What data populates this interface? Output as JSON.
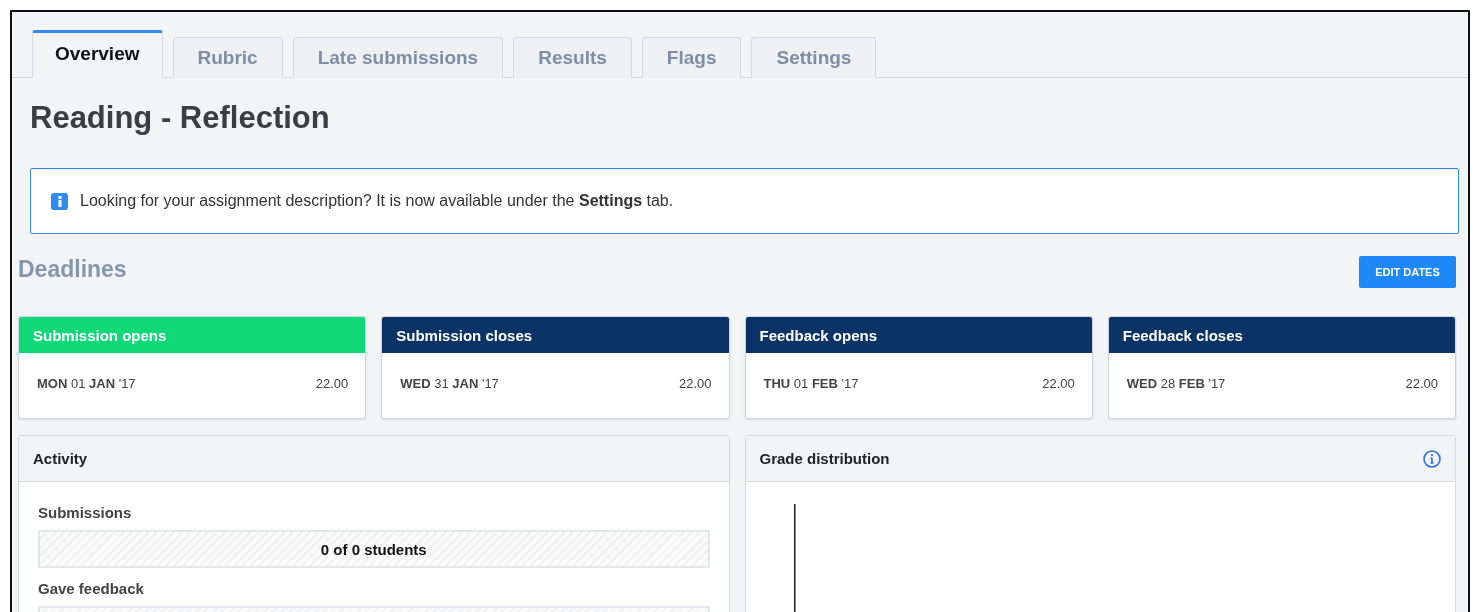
{
  "tabs": [
    {
      "label": "Overview",
      "selected": true
    },
    {
      "label": "Rubric",
      "selected": false
    },
    {
      "label": "Late submissions",
      "selected": false
    },
    {
      "label": "Results",
      "selected": false
    },
    {
      "label": "Flags",
      "selected": false
    },
    {
      "label": "Settings",
      "selected": false
    }
  ],
  "title": "Reading - Reflection",
  "notice": "Looking for your assignment description? It is now available under the **Settings** tab.",
  "deadlines": {
    "heading": "Deadlines",
    "button": "EDIT DATES",
    "cards": [
      {
        "label": "Submission opens",
        "color": "#0fd878",
        "date": "**MON** 01 **JAN** '17",
        "time": "22.00"
      },
      {
        "label": "Submission closes",
        "color": "#0b3365",
        "date": "**WED** 31 **JAN** '17",
        "time": "22.00"
      },
      {
        "label": "Feedback opens",
        "color": "#0b3365",
        "date": "**THU** 01 **FEB** '17",
        "time": "22.00"
      },
      {
        "label": "Feedback closes",
        "color": "#0b3365",
        "date": "**WED** 28 **FEB** '17",
        "time": "22.00"
      }
    ]
  },
  "activity": {
    "title": "Activity",
    "meters": [
      {
        "label": "Submissions",
        "reading": "0 of 0 students"
      },
      {
        "label": "Gave feedback"
      }
    ]
  },
  "grade_distribution": {
    "title": "Grade distribution"
  }
}
